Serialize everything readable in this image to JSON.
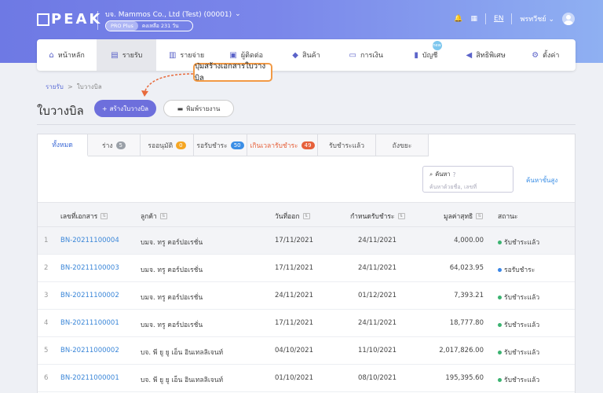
{
  "app": {
    "logo": "PEAK",
    "company": "บจ. Mammos Co., Ltd (Test) (00001)",
    "plan": "PRO Plus",
    "days_left": "คงเหลือ 231 วัน",
    "lang": "EN",
    "user": "พรทวีชย์"
  },
  "nav": [
    {
      "label": "หน้าหลัก",
      "icon": "home-icon"
    },
    {
      "label": "รายรับ",
      "icon": "income-icon"
    },
    {
      "label": "รายจ่าย",
      "icon": "expense-icon"
    },
    {
      "label": "ผู้ติดต่อ",
      "icon": "contact-icon"
    },
    {
      "label": "สินค้า",
      "icon": "product-icon"
    },
    {
      "label": "การเงิน",
      "icon": "finance-icon"
    },
    {
      "label": "บัญชี",
      "icon": "account-icon",
      "badge": "new"
    },
    {
      "label": "สิทธิพิเศษ",
      "icon": "megaphone-icon"
    },
    {
      "label": "ตั้งค่า",
      "icon": "gear-icon"
    }
  ],
  "callout": "ปุ่มสร้างเอกสารใบวางบิล",
  "breadcrumb": {
    "parent": "รายรับ",
    "sep": ">",
    "current": "ใบวางบิล"
  },
  "page_title": "ใบวางบิล",
  "buttons": {
    "create": "สร้างใบวางบิล",
    "print": "พิมพ์รายงาน"
  },
  "tabs": [
    {
      "label": "ทั้งหมด"
    },
    {
      "label": "ร่าง",
      "count": "5"
    },
    {
      "label": "รออนุมัติ",
      "count": "0"
    },
    {
      "label": "รอรับชำระ",
      "count": "50"
    },
    {
      "label": "เกินเวลารับชำระ",
      "count": "49"
    },
    {
      "label": "รับชำระแล้ว"
    },
    {
      "label": "ถังขยะ"
    }
  ],
  "search": {
    "label": "ค้นหา",
    "placeholder": "ค้นหาด้วยชื่อ, เลขที่"
  },
  "advanced_search": "ค้นหาขั้นสูง",
  "columns": {
    "doc": "เลขที่เอกสาร",
    "customer": "ลูกค้า",
    "issue": "วันที่ออก",
    "due": "กำหนดรับชำระ",
    "amount": "มูลค่าสุทธิ",
    "status": "สถานะ"
  },
  "sort_glyph": "⇅",
  "rows": [
    {
      "n": "1",
      "doc": "BN-20211100004",
      "customer": "บมจ. ทรู คอร์ปอเรชั่น",
      "issue": "17/11/2021",
      "due": "24/11/2021",
      "amount": "4,000.00",
      "status": "รับชำระแล้ว",
      "status_color": "#3cb371"
    },
    {
      "n": "2",
      "doc": "BN-20211100003",
      "customer": "บมจ. ทรู คอร์ปอเรชั่น",
      "issue": "17/11/2021",
      "due": "24/11/2021",
      "amount": "64,023.95",
      "status": "รอรับชำระ",
      "status_color": "#3a86e6"
    },
    {
      "n": "3",
      "doc": "BN-20211100002",
      "customer": "บมจ. ทรู คอร์ปอเรชั่น",
      "issue": "24/11/2021",
      "due": "01/12/2021",
      "amount": "7,393.21",
      "status": "รับชำระแล้ว",
      "status_color": "#3cb371"
    },
    {
      "n": "4",
      "doc": "BN-20211100001",
      "customer": "บมจ. ทรู คอร์ปอเรชั่น",
      "issue": "17/11/2021",
      "due": "24/11/2021",
      "amount": "18,777.80",
      "status": "รับชำระแล้ว",
      "status_color": "#3cb371"
    },
    {
      "n": "5",
      "doc": "BN-20211000002",
      "customer": "บจ. พี ยู ยู เอ็น อินเทลลิเจนท์",
      "issue": "04/10/2021",
      "due": "11/10/2021",
      "amount": "2,017,826.00",
      "status": "รับชำระแล้ว",
      "status_color": "#3cb371"
    },
    {
      "n": "6",
      "doc": "BN-20211000001",
      "customer": "บจ. พี ยู ยู เอ็น อินเทลลิเจนท์",
      "issue": "01/10/2021",
      "due": "08/10/2021",
      "amount": "195,395.60",
      "status": "รับชำระแล้ว",
      "status_color": "#3cb371"
    }
  ]
}
